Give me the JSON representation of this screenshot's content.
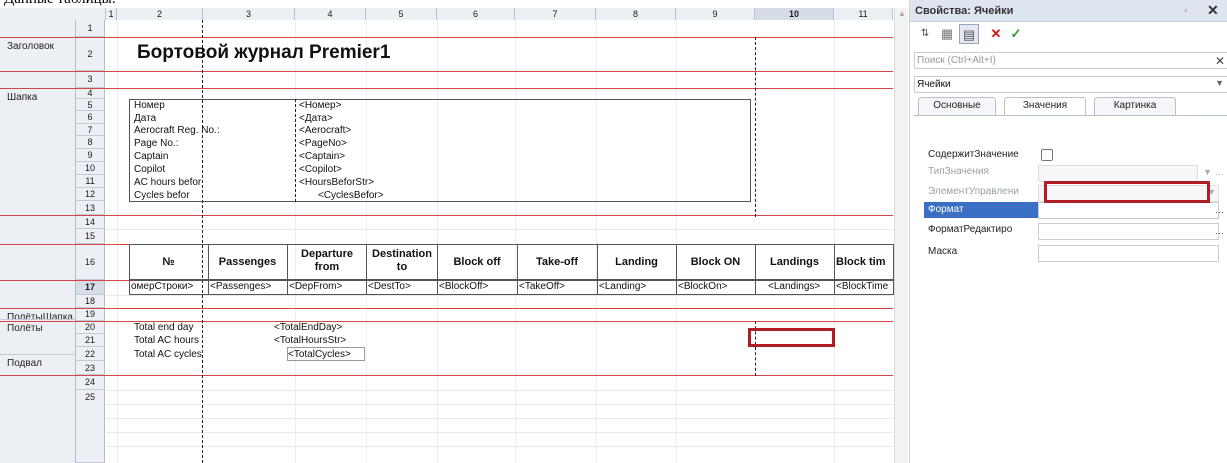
{
  "top_text": "Данные таблицы:",
  "columns": [
    "1",
    "2",
    "3",
    "4",
    "5",
    "6",
    "7",
    "8",
    "9",
    "10",
    "11"
  ],
  "rows": [
    "1",
    "2",
    "3",
    "4",
    "5",
    "6",
    "7",
    "8",
    "9",
    "10",
    "11",
    "12",
    "13",
    "14",
    "15",
    "16",
    "17",
    "18",
    "19",
    "20",
    "21",
    "22",
    "23",
    "24",
    "25"
  ],
  "groups": [
    "Заголовок",
    "Шапка",
    "ПолётыШапка",
    "Полёты",
    "Подвал"
  ],
  "title": "Бортовой журнал Premier1",
  "header_labels": [
    "Номер",
    "Дата",
    "Aerocraft Reg. No.:",
    "Page No.:",
    "Captain",
    "Copilot",
    "AC hours befor",
    "Cycles befor"
  ],
  "header_params": [
    "<Номер>",
    "<Дата>",
    "<Aerocraft>",
    "<PageNo>",
    "<Captain>",
    "<Copilot>",
    "<HoursBeforStr>",
    "<CyclesBefor>"
  ],
  "table_headers": [
    "№",
    "Passenges",
    "Departure from",
    "Destination to",
    "Block off",
    "Take-off",
    "Landing",
    "Block ON",
    "Landings",
    "Block tim"
  ],
  "table_row": [
    "омерСтроки>",
    "<Passenges>",
    "<DepFrom>",
    "<DestTo>",
    "<BlockOff>",
    "<TakeOff>",
    "<Landing>",
    "<BlockOn>",
    "<Landings>",
    "<BlockTime"
  ],
  "footer_labels": [
    "Total end day",
    "Total AC hours",
    "Total AC cycles"
  ],
  "footer_params": [
    "<TotalEndDay>",
    "<TotalHoursStr>",
    "<TotalCycles>"
  ],
  "panel": {
    "title": "Свойства: Ячейки",
    "search_placeholder": "Поиск (Ctrl+Alt+I)",
    "object": "Ячейки",
    "tabs": [
      "Основные",
      "Значения",
      "Картинка"
    ],
    "active_tab": "Значения",
    "props": [
      "СодержитЗначение",
      "ТипЗначения",
      "ЭлементУправлени",
      "Формат",
      "ФорматРедактиро",
      "Маска"
    ]
  },
  "colors": {
    "accent": "#3a6fc4",
    "highlight": "#b11d24",
    "separator": "#d64545"
  }
}
